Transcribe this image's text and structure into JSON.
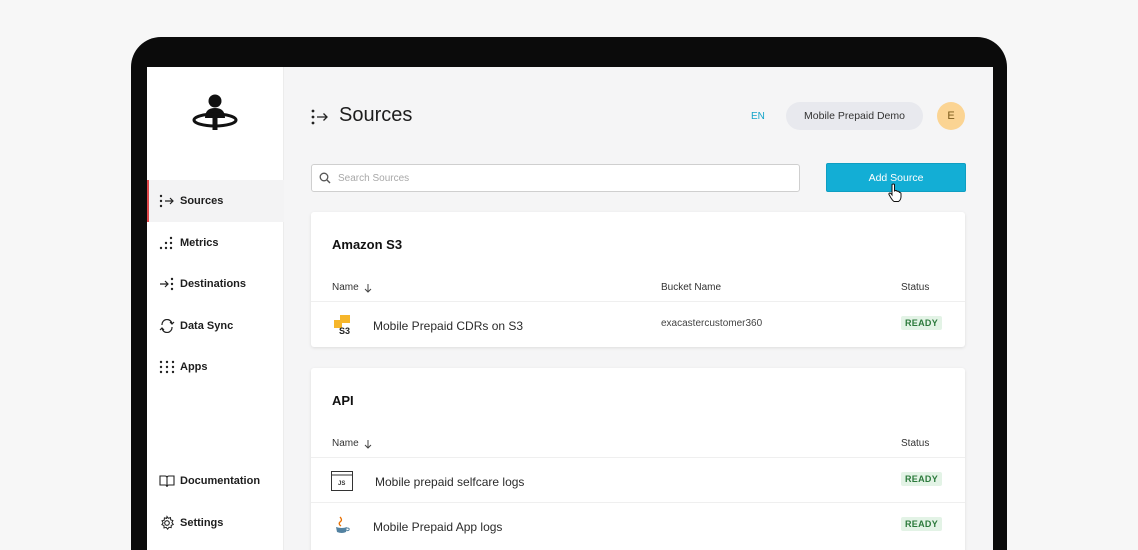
{
  "sidebar": {
    "items": [
      {
        "label": "Sources",
        "icon": "sources-icon"
      },
      {
        "label": "Metrics",
        "icon": "metrics-icon"
      },
      {
        "label": "Destinations",
        "icon": "destinations-icon"
      },
      {
        "label": "Data Sync",
        "icon": "data-sync-icon"
      },
      {
        "label": "Apps",
        "icon": "apps-icon"
      }
    ],
    "footer_items": [
      {
        "label": "Documentation",
        "icon": "book-icon"
      },
      {
        "label": "Settings",
        "icon": "gear-icon"
      }
    ]
  },
  "header": {
    "title": "Sources",
    "lang": "EN",
    "workspace": "Mobile Prepaid Demo",
    "avatar_initial": "E"
  },
  "search": {
    "placeholder": "Search Sources",
    "value": ""
  },
  "toolbar": {
    "add_label": "Add Source"
  },
  "groups": [
    {
      "title": "Amazon S3",
      "columns": {
        "name": "Name",
        "bucket": "Bucket Name",
        "status": "Status"
      },
      "rows": [
        {
          "name": "Mobile Prepaid CDRs on S3",
          "bucket": "exacastercustomer360",
          "status": "READY",
          "icon": "aws-s3-icon"
        }
      ]
    },
    {
      "title": "API",
      "columns": {
        "name": "Name",
        "status": "Status"
      },
      "rows": [
        {
          "name": "Mobile prepaid selfcare logs",
          "status": "READY",
          "icon": "javascript-file-icon"
        },
        {
          "name": "Mobile Prepaid App logs",
          "status": "READY",
          "icon": "java-icon"
        }
      ]
    }
  ],
  "colors": {
    "accent": "#13aed5",
    "active_marker": "#e1484b",
    "ready_bg": "#e3f3e6",
    "ready_text": "#2c7a3c",
    "avatar": "#fbd493"
  }
}
